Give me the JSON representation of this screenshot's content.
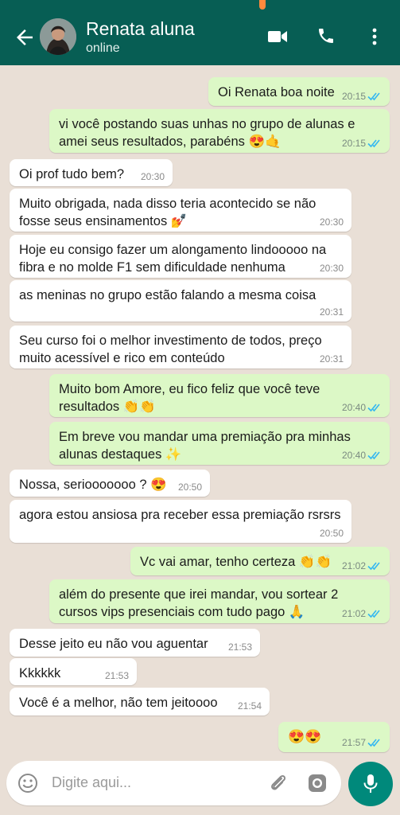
{
  "header": {
    "contact_name": "Renata aluna",
    "status": "online"
  },
  "messages": [
    {
      "dir": "out",
      "text": "Oi Renata boa noite",
      "time": "20:15",
      "read": true
    },
    {
      "dir": "out",
      "text": "vi você postando suas unhas no grupo de alunas e amei seus resultados, parabéns 😍🤙",
      "time": "20:15",
      "read": true
    },
    {
      "dir": "in",
      "text": "Oi prof tudo bem?",
      "time": "20:30"
    },
    {
      "dir": "in",
      "text": "Muito obrigada, nada disso teria acontecido se não fosse seus ensinamentos 💅",
      "time": "20:30"
    },
    {
      "dir": "in",
      "text": "Hoje eu consigo fazer um alongamento lindooooo na fibra e no molde F1 sem dificuldade nenhuma",
      "time": "20:30"
    },
    {
      "dir": "in",
      "text": "as meninas no grupo estão falando a mesma coisa",
      "time": "20:31"
    },
    {
      "dir": "in",
      "text": "Seu curso foi o melhor investimento de todos, preço muito acessível e rico em conteúdo",
      "time": "20:31"
    },
    {
      "dir": "out",
      "text": "Muito bom Amore, eu fico feliz que você teve resultados 👏👏",
      "time": "20:40",
      "read": true
    },
    {
      "dir": "out",
      "text": "Em breve vou mandar uma premiação pra minhas alunas destaques ✨",
      "time": "20:40",
      "read": true
    },
    {
      "dir": "in",
      "text": "Nossa, seriooooooo ? 😍",
      "time": "20:50"
    },
    {
      "dir": "in",
      "text": "agora estou ansiosa pra receber essa premiação rsrsrs",
      "time": "20:50"
    },
    {
      "dir": "out",
      "text": "Vc vai amar, tenho certeza 👏👏",
      "time": "21:02",
      "read": true
    },
    {
      "dir": "out",
      "text": "além do presente que irei mandar, vou sortear 2 cursos vips presenciais com tudo pago 🙏",
      "time": "21:02",
      "read": true
    },
    {
      "dir": "in",
      "text": "Desse jeito eu não vou aguentar",
      "time": "21:53"
    },
    {
      "dir": "in",
      "text": "Kkkkkk",
      "time": "21:53"
    },
    {
      "dir": "in",
      "text": "Você é a melhor, não tem jeitoooo",
      "time": "21:54"
    },
    {
      "dir": "out",
      "text": "😍😍",
      "time": "21:57",
      "read": true
    }
  ],
  "composer": {
    "placeholder": "Digite aqui..."
  },
  "colors": {
    "header": "#075e54",
    "outgoing_bubble": "#dcf8c6",
    "incoming_bubble": "#ffffff",
    "read_ticks": "#34b7f1",
    "mic_button": "#00897b",
    "wallpaper": "#e9dfd6"
  },
  "icons": {
    "back": "arrow-left-icon",
    "video": "video-call-icon",
    "call": "phone-icon",
    "menu": "more-vertical-icon",
    "emoji": "emoji-icon",
    "attach": "paperclip-icon",
    "camera": "camera-icon",
    "mic": "microphone-icon"
  }
}
